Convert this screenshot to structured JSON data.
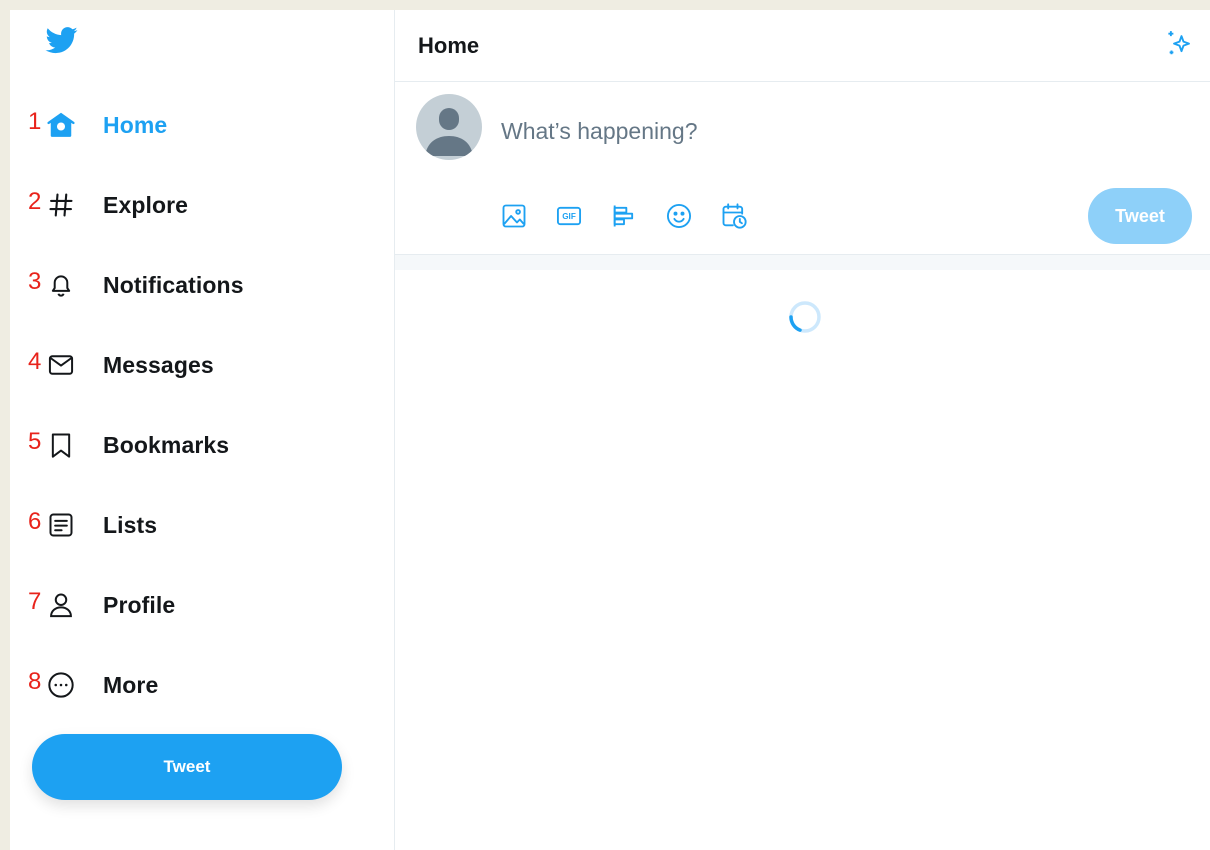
{
  "colors": {
    "accent": "#1da1f2",
    "accent_disabled": "#8ed0f9",
    "text_primary": "#14171a",
    "text_secondary": "#657786",
    "annotation_red": "#e8231b",
    "frame_background": "#efede2"
  },
  "sidebar": {
    "logo_icon": "twitter-bird-icon",
    "items": [
      {
        "number": "1",
        "icon": "home-icon",
        "label": "Home",
        "active": true
      },
      {
        "number": "2",
        "icon": "hashtag-icon",
        "label": "Explore",
        "active": false
      },
      {
        "number": "3",
        "icon": "bell-icon",
        "label": "Notifications",
        "active": false
      },
      {
        "number": "4",
        "icon": "envelope-icon",
        "label": "Messages",
        "active": false
      },
      {
        "number": "5",
        "icon": "bookmark-icon",
        "label": "Bookmarks",
        "active": false
      },
      {
        "number": "6",
        "icon": "list-icon",
        "label": "Lists",
        "active": false
      },
      {
        "number": "7",
        "icon": "person-icon",
        "label": "Profile",
        "active": false
      },
      {
        "number": "8",
        "icon": "more-circle-icon",
        "label": "More",
        "active": false
      }
    ],
    "tweet_button_label": "Tweet"
  },
  "header": {
    "title": "Home",
    "sparkle_icon": "sparkle-icon"
  },
  "composer": {
    "placeholder": "What’s happening?",
    "tools": [
      "image-icon",
      "gif-icon",
      "poll-icon",
      "emoji-icon",
      "schedule-icon"
    ],
    "tweet_button_label": "Tweet"
  },
  "feed": {
    "status_icon": "loading-spinner-icon"
  }
}
